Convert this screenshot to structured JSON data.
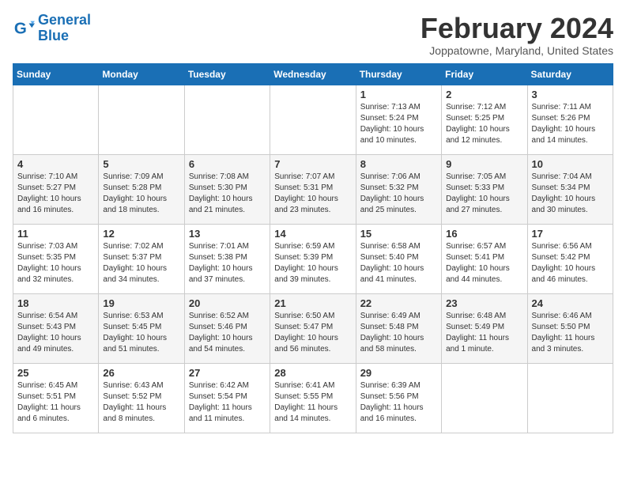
{
  "logo": {
    "name_part1": "General",
    "name_part2": "Blue"
  },
  "header": {
    "title": "February 2024",
    "subtitle": "Joppatowne, Maryland, United States"
  },
  "weekdays": [
    "Sunday",
    "Monday",
    "Tuesday",
    "Wednesday",
    "Thursday",
    "Friday",
    "Saturday"
  ],
  "weeks": [
    [
      {
        "day": "",
        "info": ""
      },
      {
        "day": "",
        "info": ""
      },
      {
        "day": "",
        "info": ""
      },
      {
        "day": "",
        "info": ""
      },
      {
        "day": "1",
        "info": "Sunrise: 7:13 AM\nSunset: 5:24 PM\nDaylight: 10 hours\nand 10 minutes."
      },
      {
        "day": "2",
        "info": "Sunrise: 7:12 AM\nSunset: 5:25 PM\nDaylight: 10 hours\nand 12 minutes."
      },
      {
        "day": "3",
        "info": "Sunrise: 7:11 AM\nSunset: 5:26 PM\nDaylight: 10 hours\nand 14 minutes."
      }
    ],
    [
      {
        "day": "4",
        "info": "Sunrise: 7:10 AM\nSunset: 5:27 PM\nDaylight: 10 hours\nand 16 minutes."
      },
      {
        "day": "5",
        "info": "Sunrise: 7:09 AM\nSunset: 5:28 PM\nDaylight: 10 hours\nand 18 minutes."
      },
      {
        "day": "6",
        "info": "Sunrise: 7:08 AM\nSunset: 5:30 PM\nDaylight: 10 hours\nand 21 minutes."
      },
      {
        "day": "7",
        "info": "Sunrise: 7:07 AM\nSunset: 5:31 PM\nDaylight: 10 hours\nand 23 minutes."
      },
      {
        "day": "8",
        "info": "Sunrise: 7:06 AM\nSunset: 5:32 PM\nDaylight: 10 hours\nand 25 minutes."
      },
      {
        "day": "9",
        "info": "Sunrise: 7:05 AM\nSunset: 5:33 PM\nDaylight: 10 hours\nand 27 minutes."
      },
      {
        "day": "10",
        "info": "Sunrise: 7:04 AM\nSunset: 5:34 PM\nDaylight: 10 hours\nand 30 minutes."
      }
    ],
    [
      {
        "day": "11",
        "info": "Sunrise: 7:03 AM\nSunset: 5:35 PM\nDaylight: 10 hours\nand 32 minutes."
      },
      {
        "day": "12",
        "info": "Sunrise: 7:02 AM\nSunset: 5:37 PM\nDaylight: 10 hours\nand 34 minutes."
      },
      {
        "day": "13",
        "info": "Sunrise: 7:01 AM\nSunset: 5:38 PM\nDaylight: 10 hours\nand 37 minutes."
      },
      {
        "day": "14",
        "info": "Sunrise: 6:59 AM\nSunset: 5:39 PM\nDaylight: 10 hours\nand 39 minutes."
      },
      {
        "day": "15",
        "info": "Sunrise: 6:58 AM\nSunset: 5:40 PM\nDaylight: 10 hours\nand 41 minutes."
      },
      {
        "day": "16",
        "info": "Sunrise: 6:57 AM\nSunset: 5:41 PM\nDaylight: 10 hours\nand 44 minutes."
      },
      {
        "day": "17",
        "info": "Sunrise: 6:56 AM\nSunset: 5:42 PM\nDaylight: 10 hours\nand 46 minutes."
      }
    ],
    [
      {
        "day": "18",
        "info": "Sunrise: 6:54 AM\nSunset: 5:43 PM\nDaylight: 10 hours\nand 49 minutes."
      },
      {
        "day": "19",
        "info": "Sunrise: 6:53 AM\nSunset: 5:45 PM\nDaylight: 10 hours\nand 51 minutes."
      },
      {
        "day": "20",
        "info": "Sunrise: 6:52 AM\nSunset: 5:46 PM\nDaylight: 10 hours\nand 54 minutes."
      },
      {
        "day": "21",
        "info": "Sunrise: 6:50 AM\nSunset: 5:47 PM\nDaylight: 10 hours\nand 56 minutes."
      },
      {
        "day": "22",
        "info": "Sunrise: 6:49 AM\nSunset: 5:48 PM\nDaylight: 10 hours\nand 58 minutes."
      },
      {
        "day": "23",
        "info": "Sunrise: 6:48 AM\nSunset: 5:49 PM\nDaylight: 11 hours\nand 1 minute."
      },
      {
        "day": "24",
        "info": "Sunrise: 6:46 AM\nSunset: 5:50 PM\nDaylight: 11 hours\nand 3 minutes."
      }
    ],
    [
      {
        "day": "25",
        "info": "Sunrise: 6:45 AM\nSunset: 5:51 PM\nDaylight: 11 hours\nand 6 minutes."
      },
      {
        "day": "26",
        "info": "Sunrise: 6:43 AM\nSunset: 5:52 PM\nDaylight: 11 hours\nand 8 minutes."
      },
      {
        "day": "27",
        "info": "Sunrise: 6:42 AM\nSunset: 5:54 PM\nDaylight: 11 hours\nand 11 minutes."
      },
      {
        "day": "28",
        "info": "Sunrise: 6:41 AM\nSunset: 5:55 PM\nDaylight: 11 hours\nand 14 minutes."
      },
      {
        "day": "29",
        "info": "Sunrise: 6:39 AM\nSunset: 5:56 PM\nDaylight: 11 hours\nand 16 minutes."
      },
      {
        "day": "",
        "info": ""
      },
      {
        "day": "",
        "info": ""
      }
    ]
  ]
}
